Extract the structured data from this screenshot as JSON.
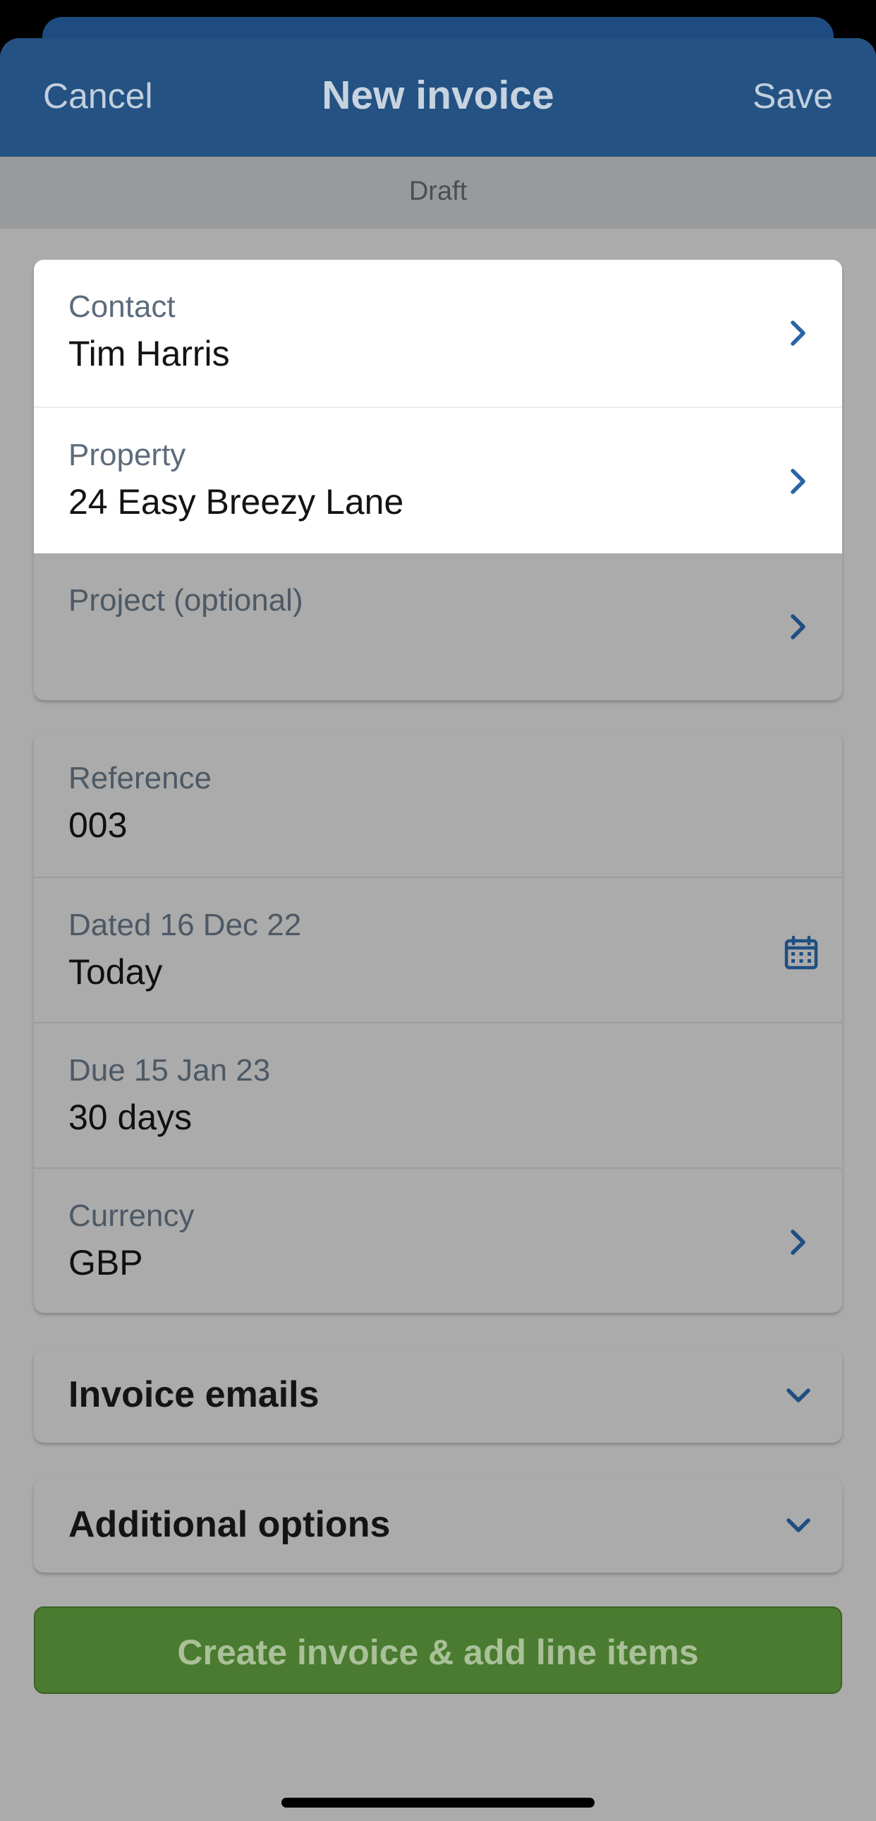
{
  "nav": {
    "cancel_label": "Cancel",
    "title": "New invoice",
    "save_label": "Save"
  },
  "status": "Draft",
  "details": {
    "contact": {
      "label": "Contact",
      "value": "Tim Harris"
    },
    "property": {
      "label": "Property",
      "value": "24 Easy Breezy Lane"
    },
    "project": {
      "label": "Project (optional)",
      "value": ""
    }
  },
  "invoice": {
    "reference": {
      "label": "Reference",
      "value": "003"
    },
    "dated": {
      "label": "Dated 16 Dec 22",
      "value": "Today"
    },
    "due": {
      "label": "Due 15 Jan 23",
      "value": "30 days"
    },
    "currency": {
      "label": "Currency",
      "value": "GBP"
    }
  },
  "sections": {
    "emails_title": "Invoice emails",
    "options_title": "Additional options"
  },
  "cta": {
    "label": "Create invoice & add line items"
  },
  "colors": {
    "nav": "#235283",
    "accent": "#2a64a6",
    "cta": "#4a7b30"
  },
  "icons": {
    "chevron": "chevron-right-icon",
    "calendar": "calendar-icon",
    "expand": "chevron-down-icon"
  }
}
